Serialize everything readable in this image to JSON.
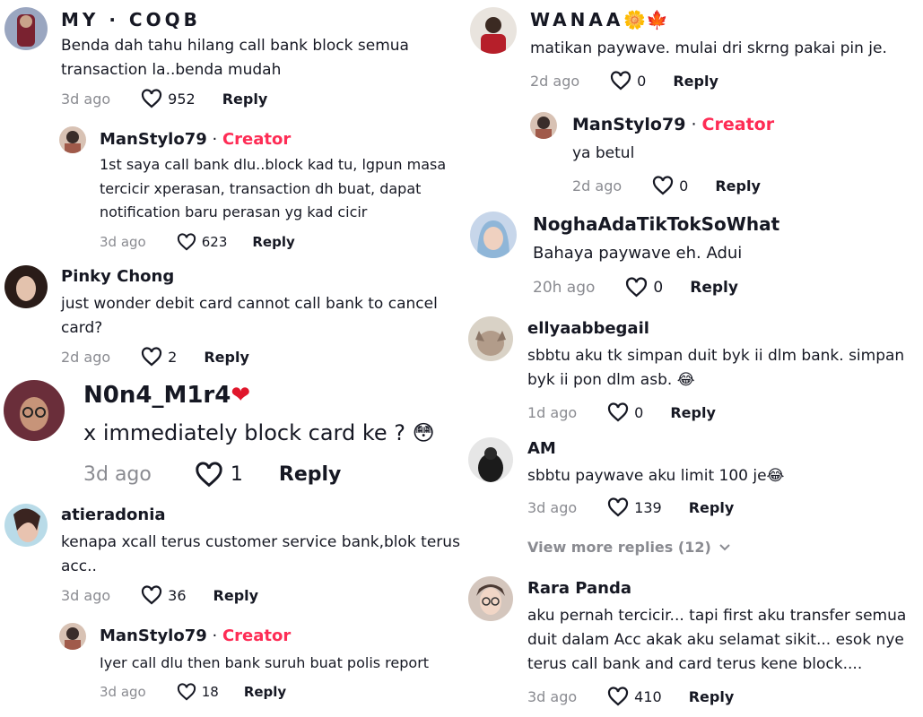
{
  "colors": {
    "creator": "#fe2c55",
    "meta": "#8a8b91",
    "text": "#161823"
  },
  "left": [
    {
      "name": "MY · COQB",
      "text": "Benda dah tahu hilang call bank block semua transaction la..benda mudah",
      "time": "3d ago",
      "likes": "952",
      "reply": "Reply"
    },
    {
      "name": "ManStylo79",
      "badge": "Creator",
      "text": "1st saya call bank dlu..block kad tu, lgpun masa tercicir xperasan, transaction dh buat, dapat notification baru perasan yg kad cicir",
      "time": "3d ago",
      "likes": "623",
      "reply": "Reply"
    },
    {
      "name": "Pinky Chong",
      "text": "just wonder debit card cannot call bank to cancel card?",
      "time": "2d ago",
      "likes": "2",
      "reply": "Reply"
    },
    {
      "name": "N0n4_M1r4",
      "name_emoji": "❤",
      "text": "x immediately block card ke ?",
      "text_emoji": "😳",
      "time": "3d ago",
      "likes": "1",
      "reply": "Reply"
    },
    {
      "name": "atieradonia",
      "text": "kenapa xcall terus customer service bank,blok terus acc..",
      "time": "3d ago",
      "likes": "36",
      "reply": "Reply"
    },
    {
      "name": "ManStylo79",
      "badge": "Creator",
      "text": "Iyer call dlu then bank suruh buat polis report",
      "time": "3d ago",
      "likes": "18",
      "reply": "Reply"
    }
  ],
  "right": [
    {
      "name": "WANAA",
      "name_emoji": "🌼🍁",
      "text": "matikan paywave. mulai dri skrng pakai pin je.",
      "time": "2d ago",
      "likes": "0",
      "reply": "Reply"
    },
    {
      "name": "ManStylo79",
      "badge": "Creator",
      "text": "ya betul",
      "time": "2d ago",
      "likes": "0",
      "reply": "Reply"
    },
    {
      "name": "NoghaAdaTikTokSoWhat",
      "text": "Bahaya paywave eh. Adui",
      "time": "20h ago",
      "likes": "0",
      "reply": "Reply"
    },
    {
      "name": "ellyaabbegail",
      "text": "sbbtu aku tk simpan duit byk ii dlm bank. simpan byk ii pon dlm asb.",
      "text_emoji": "😂",
      "time": "1d ago",
      "likes": "0",
      "reply": "Reply"
    },
    {
      "name": "AM",
      "text": "sbbtu paywave aku limit 100 je",
      "text_emoji": "😂",
      "time": "3d ago",
      "likes": "139",
      "reply": "Reply"
    },
    {
      "name": "Rara Panda",
      "text": "aku pernah tercicir... tapi first aku transfer semua duit dalam Acc akak aku selamat sikit... esok nye terus call bank and card terus kene block....",
      "time": "3d ago",
      "likes": "410",
      "reply": "Reply"
    }
  ],
  "view_more": "View more replies (12)",
  "icons": {
    "like": "heart-icon",
    "expand": "chevron-down-icon"
  }
}
